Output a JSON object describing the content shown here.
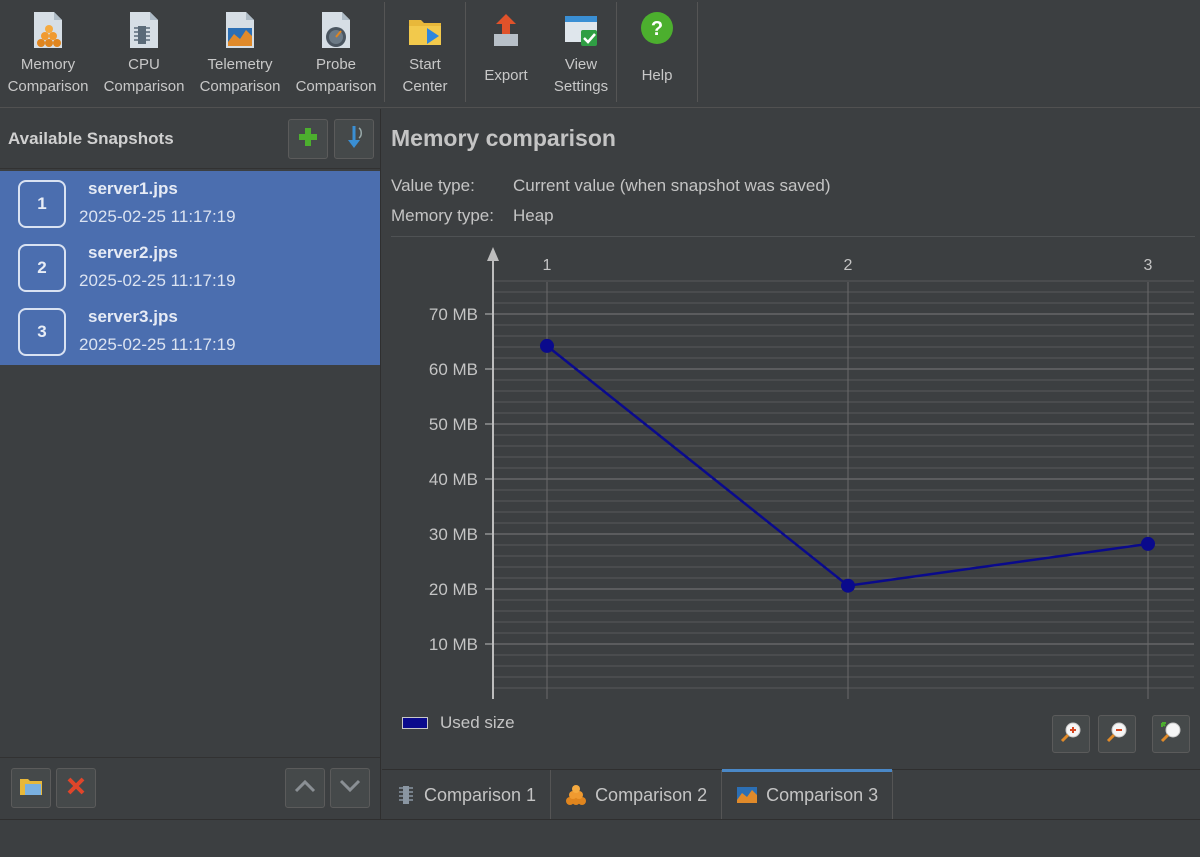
{
  "toolbar": {
    "memory": "Memory\nComparison",
    "cpu": "CPU\nComparison",
    "telemetry": "Telemetry\nComparison",
    "probe": "Probe\nComparison",
    "start": "Start\nCenter",
    "export": "Export",
    "view_settings": "View\nSettings",
    "help": "Help"
  },
  "sidebar": {
    "title": "Available Snapshots",
    "snapshots": [
      {
        "num": "1",
        "name": "server1.jps",
        "date": "2025-02-25 11:17:19"
      },
      {
        "num": "2",
        "name": "server2.jps",
        "date": "2025-02-25 11:17:19"
      },
      {
        "num": "3",
        "name": "server3.jps",
        "date": "2025-02-25 11:17:19"
      }
    ]
  },
  "main": {
    "title": "Memory comparison",
    "value_type_label": "Value type:",
    "value_type": "Current value (when snapshot was saved)",
    "memory_type_label": "Memory type:",
    "memory_type": "Heap",
    "legend": "Used size"
  },
  "tabs": [
    {
      "label": "Comparison 1"
    },
    {
      "label": "Comparison 2"
    },
    {
      "label": "Comparison 3"
    }
  ],
  "colors": {
    "selection": "#4b6eaf",
    "series": "#0a0a8c",
    "accent": "#4a88c7"
  },
  "chart_data": {
    "type": "line",
    "categories": [
      "1",
      "2",
      "3"
    ],
    "series": [
      {
        "name": "Used size",
        "values": [
          64.2,
          20.6,
          28.2
        ]
      }
    ],
    "yticks": [
      "10 MB",
      "20 MB",
      "30 MB",
      "40 MB",
      "50 MB",
      "60 MB",
      "70 MB"
    ],
    "ytick_values": [
      10,
      20,
      30,
      40,
      50,
      60,
      70
    ],
    "unit": "MB",
    "ylim": [
      0,
      80
    ],
    "grid": true
  }
}
